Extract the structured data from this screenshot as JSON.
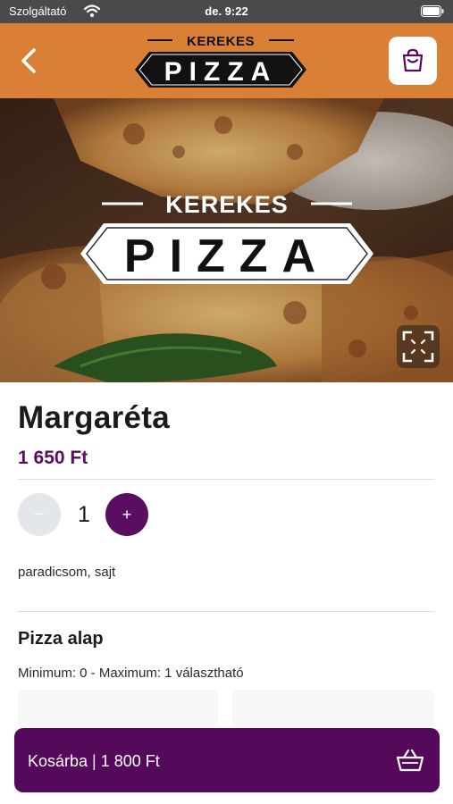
{
  "status_bar": {
    "carrier": "Szolgáltató",
    "time": "de. 9:22"
  },
  "header": {
    "logo_top": "KEREKES",
    "logo_bottom": "PIZZA",
    "brand_color": "#d97f36"
  },
  "hero": {
    "logo_top": "KEREKES",
    "logo_bottom": "PIZZA"
  },
  "product": {
    "name": "Margaréta",
    "price": "1 650 Ft",
    "quantity": "1",
    "minus_label": "−",
    "plus_label": "+",
    "ingredients": "paradicsom, sajt"
  },
  "options_section": {
    "title": "Pizza alap",
    "subtitle": "Minimum: 0 - Maximum: 1 választható"
  },
  "cart_bar": {
    "label": "Kosárba | 1 800 Ft",
    "accent_color": "#55095b"
  },
  "icons": [
    "wifi-icon",
    "battery-icon",
    "back-chevron-icon",
    "shopping-bag-icon",
    "expand-icon",
    "basket-icon"
  ]
}
